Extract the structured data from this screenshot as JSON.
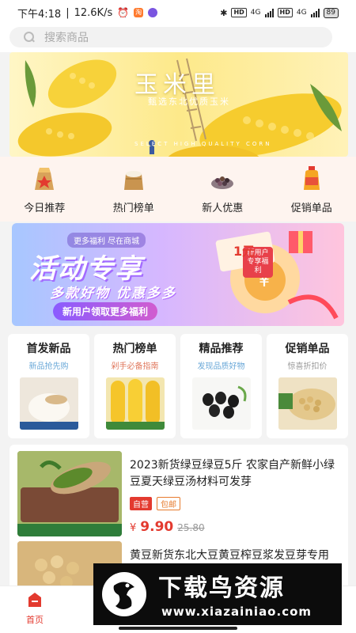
{
  "status_bar": {
    "time": "下午4:18",
    "network_speed": "12.6K/s",
    "app_badge": "淘",
    "network_1": "4G",
    "network_2": "4G",
    "battery": "89"
  },
  "search": {
    "placeholder": "搜索商品"
  },
  "banner": {
    "title": "玉米里",
    "subtitle": "甄选东北优质玉米",
    "tagline": "SELECT HIGH QUALITY CORN"
  },
  "categories": [
    {
      "label": "今日推荐",
      "icon": "rice-sack-icon"
    },
    {
      "label": "热门榜单",
      "icon": "flour-sack-icon"
    },
    {
      "label": "新人优惠",
      "icon": "beans-icon"
    },
    {
      "label": "促销单品",
      "icon": "oil-bottle-icon"
    }
  ],
  "promo": {
    "top_label": "更多福利 尽在商城",
    "title": "活动专享",
    "subtitle": "多款好物 优惠多多",
    "button": "新用户领取更多福利",
    "badge": "新用户专享福利",
    "coupon_value": "1元"
  },
  "sections": [
    {
      "title": "首发新品",
      "subtitle": "新品抢先购",
      "subtitle_color": "#6aa8d8"
    },
    {
      "title": "热门榜单",
      "subtitle": "剁手必备指南",
      "subtitle_color": "#e0795e"
    },
    {
      "title": "精品推荐",
      "subtitle": "发现品质好物",
      "subtitle_color": "#6aa8d8"
    },
    {
      "title": "促销单品",
      "subtitle": "惊喜折扣价",
      "subtitle_color": "#9a9a9a"
    }
  ],
  "products": [
    {
      "title": "2023新货绿豆绿豆5斤 农家自产新鲜小绿豆夏天绿豆汤材料可发芽",
      "tag_self": "自营",
      "tag_ship": "包邮",
      "price_currency": "¥",
      "price_now": "9.90",
      "price_old": "25.80"
    },
    {
      "title": "黄豆新货东北大豆黄豆榨豆浆发豆芽专用非转基因农家自种"
    }
  ],
  "tabbar": {
    "home_label": "首页"
  },
  "watermark": {
    "title": "下载鸟资源",
    "url": "www.xiazainiao.com"
  },
  "colors": {
    "accent": "#e33a2f",
    "category_bg": "#fef4ef",
    "page_bg": "#f3f3f3"
  }
}
